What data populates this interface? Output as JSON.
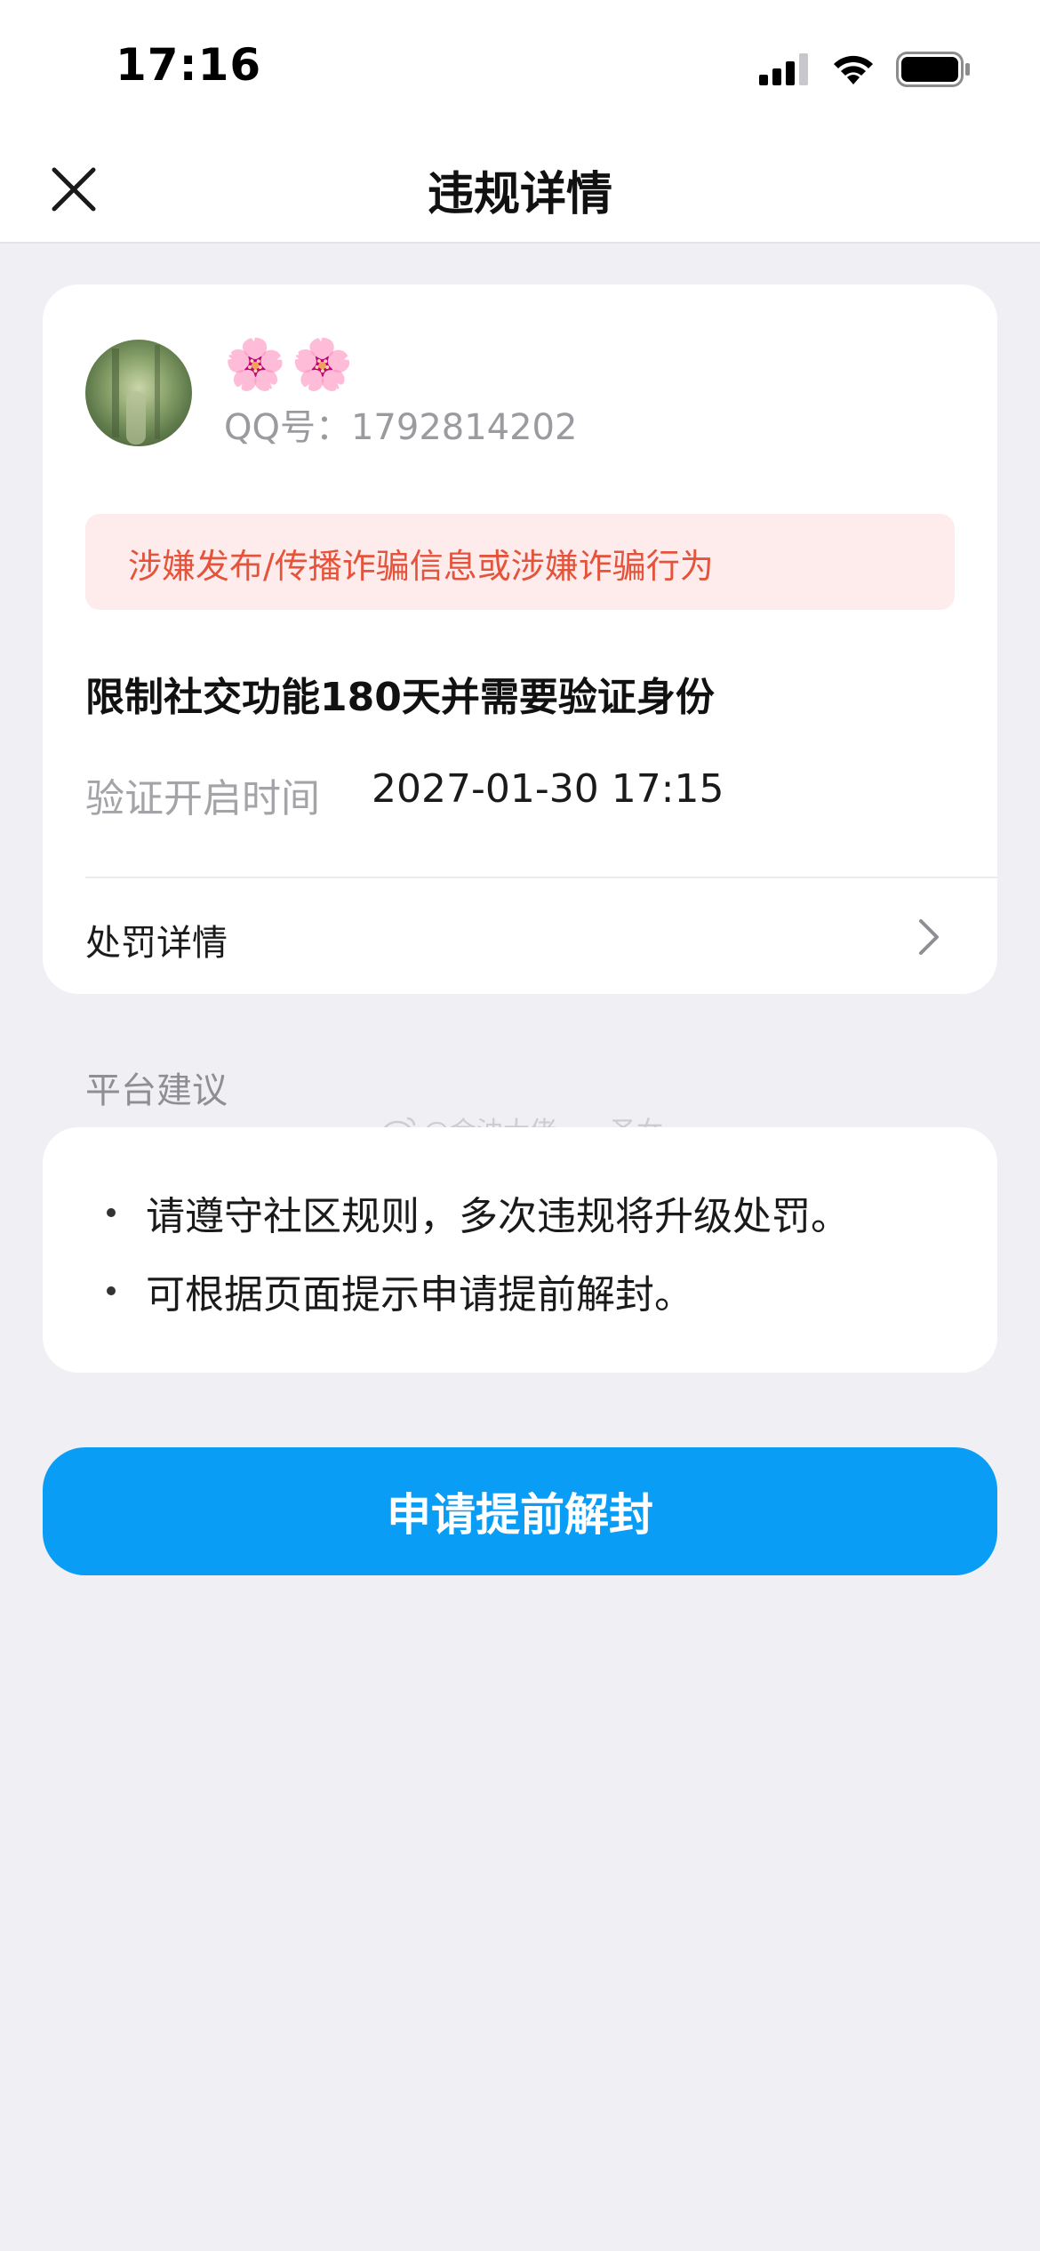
{
  "status_bar": {
    "time": "17:16"
  },
  "nav": {
    "title": "违规详情"
  },
  "profile": {
    "nickname": "🌸🌸",
    "qq_label": "QQ号：1792814202"
  },
  "violation": {
    "reason": "涉嫌发布/传播诈骗信息或涉嫌诈骗行为",
    "penalty": "限制社交功能180天并需要验证身份",
    "verify_label": "验证开启时间",
    "verify_time": "2027-01-30 17:15",
    "details_label": "处罚详情"
  },
  "suggestions": {
    "title": "平台建议",
    "items": [
      "请遵守社区规则，多次违规将升级处罚。",
      "可根据页面提示申请提前解封。"
    ]
  },
  "watermark": "@金油大佬一一圣女",
  "action": {
    "button_label": "申请提前解封"
  },
  "colors": {
    "accent": "#0a9df5",
    "warning_text": "#e4533b",
    "warning_bg": "#fdeceb",
    "page_bg": "#efeff4"
  },
  "icons": {
    "close": "close-icon",
    "chevron": "chevron-right-icon",
    "signal": "cellular-signal-icon",
    "wifi": "wifi-icon",
    "battery": "battery-icon"
  }
}
